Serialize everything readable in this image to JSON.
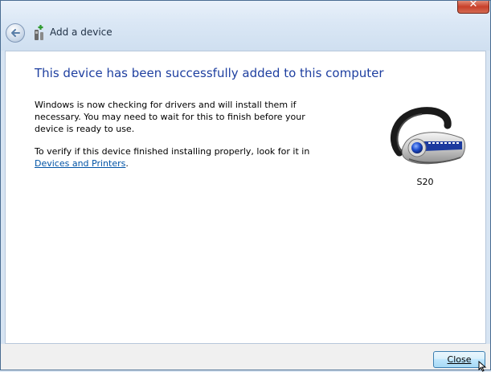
{
  "window": {
    "title": "Add a device",
    "close_glyph": "✕"
  },
  "icons": {
    "back": "back-arrow-icon",
    "title": "add-device-icon",
    "device": "bluetooth-headset-icon"
  },
  "content": {
    "heading": "This device has been successfully added to this computer",
    "paragraph1": "Windows is now checking for drivers and will install them if necessary. You may need to wait for this to finish before your device is ready to use.",
    "paragraph2_text": "To verify if this device finished installing properly, look for it in",
    "paragraph2_link": "Devices and Printers",
    "paragraph2_end": ".",
    "device_name": "S20"
  },
  "footer": {
    "close_label": "Close"
  },
  "colors": {
    "heading": "#1e3fa0",
    "link": "#0053a6",
    "button_border": "#3c7fb1"
  }
}
